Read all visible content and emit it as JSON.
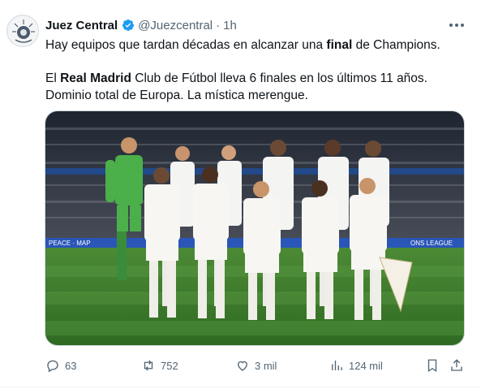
{
  "author": {
    "name": "Juez Central",
    "handle": "@Juezcentral",
    "separator": "·",
    "time": "1h"
  },
  "tweet": {
    "line1_pre": "Hay equipos que tardan décadas en alcanzar una ",
    "line1_bold": "final",
    "line1_post": " de Champions.",
    "line2_pre": "El ",
    "line2_bold": "Real Madrid",
    "line2_post": " Club de Fútbol lleva 6 finales en los últimos 11 años.",
    "line3": "Dominio total de Europa. La mística merengue."
  },
  "media": {
    "ad_board_left": "PEACE · MAP",
    "ad_board_right": "ONS LEAGUE"
  },
  "actions": {
    "replies": "63",
    "retweets": "752",
    "likes": "3 mil",
    "views": "124 mil"
  },
  "colors": {
    "verified": "#1d9bf0",
    "muted": "#536471",
    "pitch": "#3d7a2a"
  }
}
